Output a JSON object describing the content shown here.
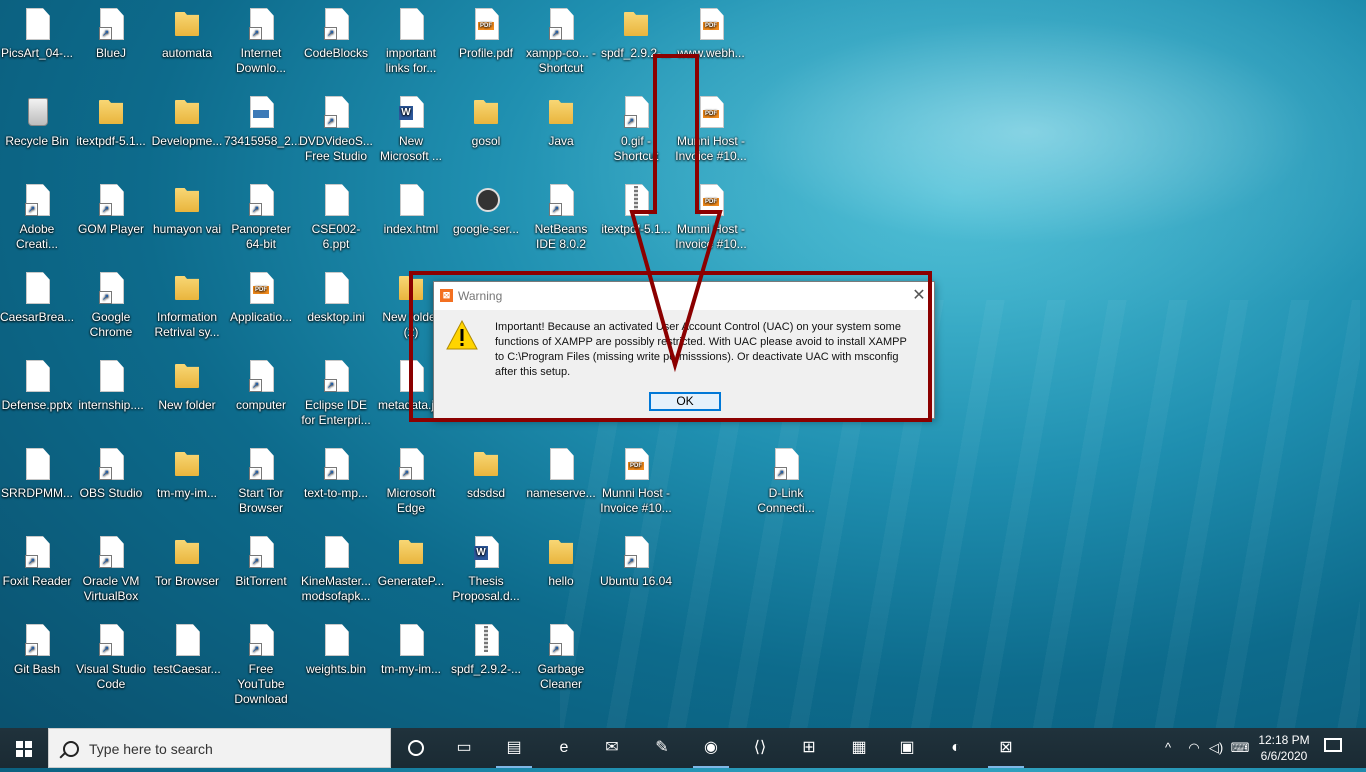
{
  "desktop_icons": [
    {
      "label": "PicsArt_04-...",
      "type": "file"
    },
    {
      "label": "BlueJ",
      "type": "shortcut"
    },
    {
      "label": "automata",
      "type": "folder"
    },
    {
      "label": "Internet Downlo...",
      "type": "shortcut"
    },
    {
      "label": "CodeBlocks",
      "type": "shortcut"
    },
    {
      "label": "important links for...",
      "type": "file"
    },
    {
      "label": "Profile.pdf",
      "type": "pdf"
    },
    {
      "label": "xampp-co... - Shortcut",
      "type": "shortcut"
    },
    {
      "label": "spdf_2.9.2-...",
      "type": "folder"
    },
    {
      "label": "www.webh...",
      "type": "pdf"
    },
    {
      "label": "Recycle Bin",
      "type": "recycle"
    },
    {
      "label": "itextpdf-5.1...",
      "type": "folder"
    },
    {
      "label": "Developme...",
      "type": "folder"
    },
    {
      "label": "73415958_2...",
      "type": "image"
    },
    {
      "label": "DVDVideoS... Free Studio",
      "type": "shortcut"
    },
    {
      "label": "New Microsoft ...",
      "type": "word"
    },
    {
      "label": "gosol",
      "type": "folder"
    },
    {
      "label": "Java",
      "type": "folder"
    },
    {
      "label": "0.gif - Shortcut",
      "type": "shortcut"
    },
    {
      "label": "Munni Host - Invoice #10...",
      "type": "pdf"
    },
    {
      "label": "Adobe Creati...",
      "type": "shortcut"
    },
    {
      "label": "GOM Player",
      "type": "shortcut"
    },
    {
      "label": "humayon vai",
      "type": "folder"
    },
    {
      "label": "Panopreter 64-bit",
      "type": "shortcut"
    },
    {
      "label": "CSE002-6.ppt",
      "type": "file"
    },
    {
      "label": "index.html",
      "type": "file"
    },
    {
      "label": "google-ser...",
      "type": "app"
    },
    {
      "label": "NetBeans IDE 8.0.2",
      "type": "shortcut"
    },
    {
      "label": "itextpdf-5.1...",
      "type": "zip"
    },
    {
      "label": "Munni Host - Invoice #10...",
      "type": "pdf"
    },
    {
      "label": "CaesarBrea...",
      "type": "file"
    },
    {
      "label": "Google Chrome",
      "type": "shortcut"
    },
    {
      "label": "Information Retrival sy...",
      "type": "folder"
    },
    {
      "label": "Applicatio...",
      "type": "pdf"
    },
    {
      "label": "desktop.ini",
      "type": "file"
    },
    {
      "label": "New folder (2)",
      "type": "folder"
    },
    {
      "label": "Defense.pptx",
      "type": "file"
    },
    {
      "label": "internship....",
      "type": "file"
    },
    {
      "label": "New folder",
      "type": "folder"
    },
    {
      "label": "computer",
      "type": "shortcut"
    },
    {
      "label": "Eclipse IDE for Enterpri...",
      "type": "shortcut"
    },
    {
      "label": "metadata.j...",
      "type": "file"
    },
    {
      "label": "SRRDPMM...",
      "type": "file"
    },
    {
      "label": "OBS Studio",
      "type": "shortcut"
    },
    {
      "label": "tm-my-im...",
      "type": "folder"
    },
    {
      "label": "Start Tor Browser",
      "type": "shortcut"
    },
    {
      "label": "text-to-mp...",
      "type": "shortcut"
    },
    {
      "label": "Microsoft Edge",
      "type": "shortcut"
    },
    {
      "label": "sdsdsd",
      "type": "folder"
    },
    {
      "label": "nameserve...",
      "type": "file"
    },
    {
      "label": "Munni Host - Invoice #10...",
      "type": "pdf"
    },
    {
      "label": "D-Link Connecti...",
      "type": "shortcut"
    },
    {
      "label": "Foxit Reader",
      "type": "shortcut"
    },
    {
      "label": "Oracle VM VirtualBox",
      "type": "shortcut"
    },
    {
      "label": "Tor Browser",
      "type": "folder"
    },
    {
      "label": "BitTorrent",
      "type": "shortcut"
    },
    {
      "label": "KineMaster... modsofapk...",
      "type": "file"
    },
    {
      "label": "GenerateP...",
      "type": "folder"
    },
    {
      "label": "Thesis Proposal.d...",
      "type": "word"
    },
    {
      "label": "hello",
      "type": "folder"
    },
    {
      "label": "Ubuntu 16.04",
      "type": "shortcut"
    },
    {
      "label": "Git Bash",
      "type": "shortcut"
    },
    {
      "label": "Visual Studio Code",
      "type": "shortcut"
    },
    {
      "label": "testCaesar...",
      "type": "file"
    },
    {
      "label": "Free YouTube Download",
      "type": "shortcut"
    },
    {
      "label": "weights.bin",
      "type": "file"
    },
    {
      "label": "tm-my-im...",
      "type": "file"
    },
    {
      "label": "spdf_2.9.2-...",
      "type": "zip"
    },
    {
      "label": "Garbage Cleaner",
      "type": "shortcut"
    }
  ],
  "dialog": {
    "title": "Warning",
    "close_glyph": "✕",
    "app_glyph": "⊠",
    "message": "Important! Because an activated User Account Control (UAC) on your system some functions of XAMPP are possibly restricted. With UAC please avoid to install XAMPP to C:\\Program Files (missing write permisssions). Or deactivate UAC with msconfig after this setup.",
    "ok_label": "OK"
  },
  "taskbar": {
    "search_placeholder": "Type here to search",
    "apps": [
      {
        "name": "task-view-icon",
        "glyph": "▭"
      },
      {
        "name": "file-explorer-icon",
        "glyph": "▤"
      },
      {
        "name": "edge-icon",
        "glyph": "e"
      },
      {
        "name": "mail-icon",
        "glyph": "✉"
      },
      {
        "name": "paint-icon",
        "glyph": "✎"
      },
      {
        "name": "chrome-icon",
        "glyph": "◉"
      },
      {
        "name": "vscode-icon",
        "glyph": "⟨⟩"
      },
      {
        "name": "store-icon",
        "glyph": "⊞"
      },
      {
        "name": "winrar-icon",
        "glyph": "▦"
      },
      {
        "name": "remote-desktop-icon",
        "glyph": "▣"
      },
      {
        "name": "eclipse-icon",
        "glyph": "◐"
      },
      {
        "name": "xampp-taskbar-icon",
        "glyph": "⊠"
      }
    ],
    "time": "12:18 PM",
    "date": "6/6/2020",
    "tray_glyphs": [
      "^",
      "◠",
      "◁)",
      "⌨"
    ]
  }
}
